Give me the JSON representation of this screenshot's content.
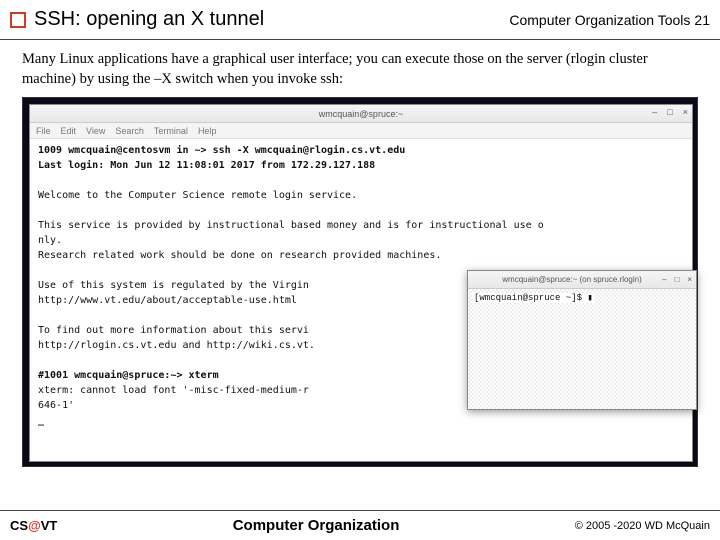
{
  "header": {
    "title": "SSH: opening an X tunnel",
    "course": "Computer Organization Tools",
    "page": "21"
  },
  "body": {
    "paragraph": "Many Linux applications have a graphical user interface; you can execute those on the server (rlogin cluster machine) by using the –X switch when you invoke ssh:"
  },
  "terminal_main": {
    "title": "wmcquain@spruce:~",
    "menu": [
      "File",
      "Edit",
      "View",
      "Search",
      "Terminal",
      "Help"
    ],
    "win_controls": [
      "–",
      "□",
      "×"
    ],
    "lines": [
      {
        "text": "1009 wmcquain@centosvm in ~> ssh -X wmcquain@rlogin.cs.vt.edu",
        "bold": true
      },
      {
        "text": "Last login: Mon Jun 12 11:08:01 2017 from 172.29.127.188",
        "bold": true
      },
      {
        "text": "",
        "bold": false
      },
      {
        "text": "Welcome to the Computer Science remote login service.",
        "bold": false
      },
      {
        "text": "",
        "bold": false
      },
      {
        "text": "This service is provided by instructional based money and is for instructional use o",
        "bold": false
      },
      {
        "text": "nly.",
        "bold": false
      },
      {
        "text": "Research related work should be done on research provided machines.",
        "bold": false
      },
      {
        "text": "",
        "bold": false
      },
      {
        "text": "Use of this system is regulated by the Virgin",
        "bold": false
      },
      {
        "text": "http://www.vt.edu/about/acceptable-use.html",
        "bold": false
      },
      {
        "text": "",
        "bold": false
      },
      {
        "text": "To find out more information about this servi",
        "bold": false
      },
      {
        "text": "http://rlogin.cs.vt.edu and http://wiki.cs.vt.",
        "bold": false
      },
      {
        "text": "",
        "bold": false
      },
      {
        "text": "#1001 wmcquain@spruce:~> xterm",
        "bold": true
      },
      {
        "text": "xterm: cannot load font '-misc-fixed-medium-r",
        "bold": false
      },
      {
        "text": "646-1'",
        "bold": false
      },
      {
        "text": "_",
        "bold": true
      }
    ]
  },
  "terminal_xterm": {
    "title": "wmcquain@spruce:~ (on spruce.rlogin)",
    "win_controls": [
      "–",
      "□",
      "×"
    ],
    "prompt": "[wmcquain@spruce ~]$ ▮"
  },
  "footer": {
    "left_pre": "CS",
    "left_at": "@",
    "left_post": "VT",
    "center": "Computer Organization",
    "right": "© 2005 -2020 WD McQuain"
  }
}
